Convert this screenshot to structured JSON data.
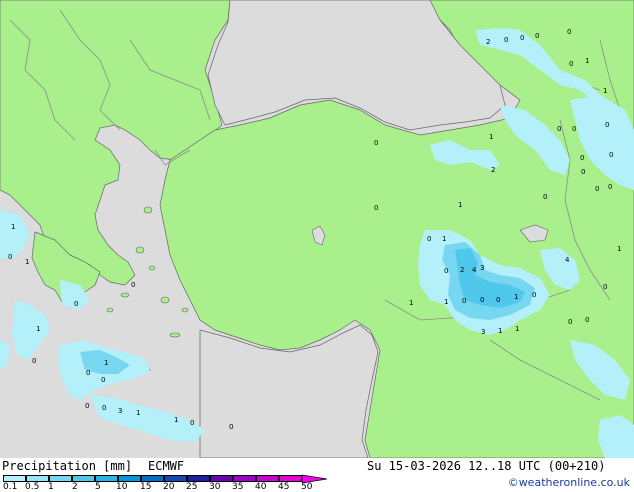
{
  "header": {
    "title": "Precipitation [mm]",
    "model": "ECMWF",
    "valid_time": "Su 15-03-2026 12..18 UTC (00+210)",
    "credit": "©weatheronline.co.uk"
  },
  "legend": {
    "ticks": [
      "0.1",
      "0.5",
      "1",
      "2",
      "5",
      "10",
      "15",
      "20",
      "25",
      "30",
      "35",
      "40",
      "45",
      "50"
    ],
    "colors": [
      "#b4f0fa",
      "#96e6f5",
      "#78d7f0",
      "#50c8eb",
      "#28b4e6",
      "#0096dc",
      "#0a6ec8",
      "#1446b4",
      "#1e1ea0",
      "#6e00b4",
      "#a000c8",
      "#c800d2",
      "#e600dc",
      "#f000f0"
    ]
  },
  "colors": {
    "land": "#a9f08c",
    "sea": "#dcdcdc",
    "border": "#8c8c8c",
    "coast": "#666666",
    "precip_light": "#b4f0fa",
    "precip_mid": "#78d7f0",
    "precip_heavy": "#50c8eb"
  },
  "map_labels": [
    "2",
    "0",
    "0",
    "0",
    "0",
    "0",
    "1",
    "1",
    "0",
    "0",
    "0",
    "1",
    "0",
    "0",
    "0",
    "2",
    "0",
    "0",
    "0",
    "0",
    "0",
    "1",
    "1",
    "0",
    "1",
    "1",
    "0",
    "1",
    "4",
    "0",
    "2",
    "4",
    "3",
    "0",
    "0",
    "1",
    "0",
    "0",
    "0",
    "1",
    "0",
    "0",
    "1",
    "1",
    "0",
    "0",
    "3",
    "1",
    "1",
    "0",
    "0"
  ]
}
